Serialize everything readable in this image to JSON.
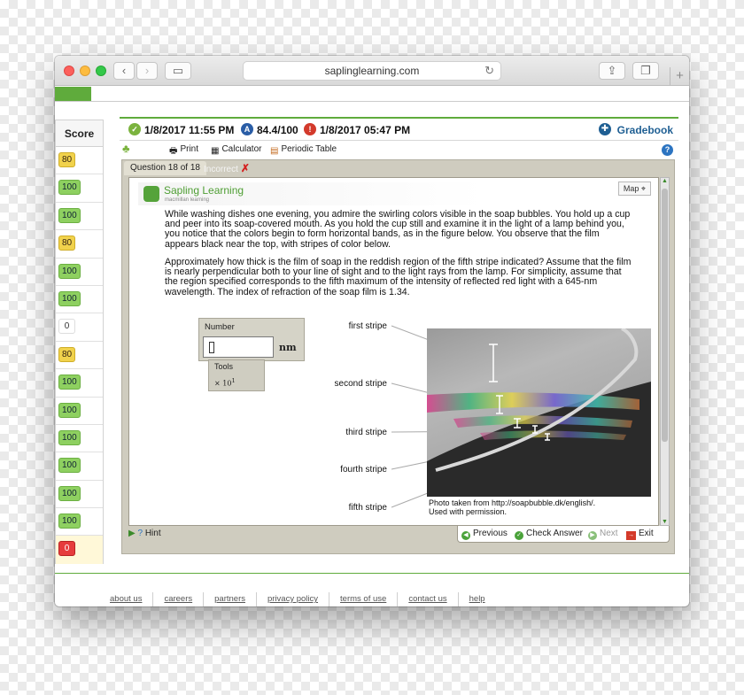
{
  "browser": {
    "url": "saplinglearning.com"
  },
  "scores": {
    "header": "Score",
    "items": [
      {
        "value": "80",
        "color": "yellow"
      },
      {
        "value": "100",
        "color": "green"
      },
      {
        "value": "100",
        "color": "green"
      },
      {
        "value": "80",
        "color": "yellow"
      },
      {
        "value": "100",
        "color": "green"
      },
      {
        "value": "100",
        "color": "green"
      },
      {
        "value": "0",
        "color": "white"
      },
      {
        "value": "80",
        "color": "yellow"
      },
      {
        "value": "100",
        "color": "green"
      },
      {
        "value": "100",
        "color": "green"
      },
      {
        "value": "100",
        "color": "green"
      },
      {
        "value": "100",
        "color": "green"
      },
      {
        "value": "100",
        "color": "green"
      },
      {
        "value": "100",
        "color": "green"
      },
      {
        "value": "0",
        "color": "red"
      }
    ]
  },
  "info": {
    "opened": "1/8/2017 11:55 PM",
    "score": "84.4/100",
    "due": "1/8/2017 05:47 PM",
    "gradebook": "Gradebook"
  },
  "toolbar": {
    "print": "Print",
    "calculator": "Calculator",
    "periodic_table": "Periodic Table"
  },
  "question": {
    "tab_label": "Question 18 of 18",
    "status": "Incorrect",
    "brand": "Sapling Learning",
    "brand_sub": "macmillan learning",
    "map_label": "Map",
    "paragraph1": "While washing dishes one evening, you admire the swirling colors visible in the soap bubbles. You hold up a cup and peer into its soap-covered mouth. As you hold the cup still and examine it in the light of a lamp behind you, you notice that the colors begin to form horizontal bands, as in the figure below. You observe that the film appears black near the top, with stripes of color below.",
    "paragraph2": "Approximately how thick is the film of soap in the reddish region of the fifth stripe indicated? Assume that the film is nearly perpendicular both to your line of sight and to the light rays from the lamp. For simplicity, assume that the region specified corresponds to the fifth maximum of the intensity of reflected red light with a 645-nm wavelength. The index of refraction of the soap film is 1.34.",
    "input_label": "Number",
    "input_value": "",
    "unit": "nm",
    "tools_label": "Tools",
    "tools_sci": "× 10",
    "tools_sci_exp": "1",
    "stripes": [
      "first stripe",
      "second stripe",
      "third stripe",
      "fourth stripe",
      "fifth stripe"
    ],
    "caption_line1": "Photo taken from http://soapbubble.dk/english/.",
    "caption_line2": "Used with permission."
  },
  "nav": {
    "hint": "Hint",
    "previous": "Previous",
    "check": "Check Answer",
    "next": "Next",
    "exit": "Exit"
  },
  "footer": [
    "about us",
    "careers",
    "partners",
    "privacy policy",
    "terms of use",
    "contact us",
    "help"
  ]
}
